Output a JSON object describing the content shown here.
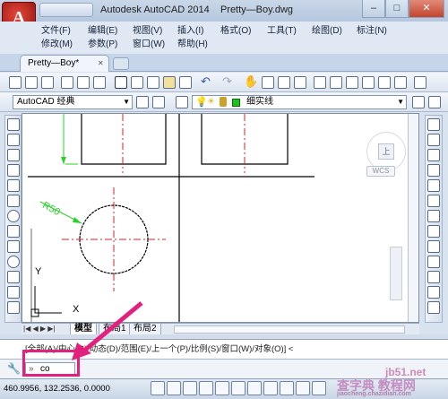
{
  "app": {
    "title": "Autodesk AutoCAD 2014",
    "filename": "Pretty—Boy.dwg",
    "logo": "A"
  },
  "window_buttons": {
    "minimize": "–",
    "maximize": "□",
    "close": "✕"
  },
  "menu_row1": [
    "文件(F)",
    "编辑(E)",
    "视图(V)",
    "插入(I)",
    "格式(O)",
    "工具(T)",
    "绘图(D)",
    "标注(N)"
  ],
  "menu_row2": [
    "修改(M)",
    "参数(P)",
    "窗口(W)",
    "帮助(H)"
  ],
  "doc_tab": {
    "label": "Pretty—Boy*",
    "close": "✕"
  },
  "workspace": {
    "value": "AutoCAD 经典"
  },
  "layer": {
    "value": "细实线"
  },
  "viewcube": {
    "face": "上",
    "wcs": "WCS"
  },
  "drawing": {
    "dim_label": "R50",
    "ucs_x": "X",
    "ucs_y": "Y"
  },
  "layout_tabs": [
    "模型",
    "布局1",
    "布局2"
  ],
  "command": {
    "history": "[全部(A)/中心(C)/动态(D)/范围(E)/上一个(P)/比例(S)/窗口(W)/对象(O)] <",
    "input": "co",
    "prefix": "»"
  },
  "status": {
    "coords": "460.9956,  132.2536,  0.0000"
  },
  "watermark": {
    "line1": "查字典 教程网",
    "line2": "jiaocheng.chazidian.com",
    "site": "jb51.net"
  },
  "colors": {
    "accent": "#e2217f",
    "titlebar": "#b5c7de",
    "model_red": "#d3262c",
    "dim_green": "#2ad12a"
  }
}
